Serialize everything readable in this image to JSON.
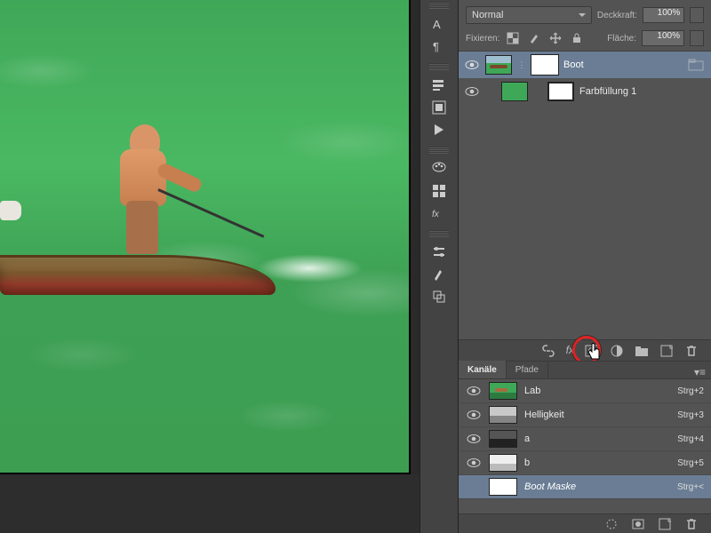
{
  "layers_panel": {
    "blend_mode": "Normal",
    "opacity_label": "Deckkraft:",
    "opacity_value": "100%",
    "lock_label": "Fixieren:",
    "fill_label": "Fläche:",
    "fill_value": "100%",
    "items": [
      {
        "name": "Boot",
        "selected": true
      },
      {
        "name": "Farbfüllung 1",
        "selected": false
      }
    ]
  },
  "channels_panel": {
    "tabs": {
      "channels": "Kanäle",
      "paths": "Pfade"
    },
    "items": [
      {
        "name": "Lab",
        "shortcut": "Strg+2",
        "thumb": "lab"
      },
      {
        "name": "Helligkeit",
        "shortcut": "Strg+3",
        "thumb": "hell"
      },
      {
        "name": "a",
        "shortcut": "Strg+4",
        "thumb": "a"
      },
      {
        "name": "b",
        "shortcut": "Strg+5",
        "thumb": "b"
      },
      {
        "name": "Boot Maske",
        "shortcut": "Strg+<",
        "thumb": "mask",
        "selected": true
      }
    ]
  },
  "icons": {
    "fx": "fx"
  }
}
